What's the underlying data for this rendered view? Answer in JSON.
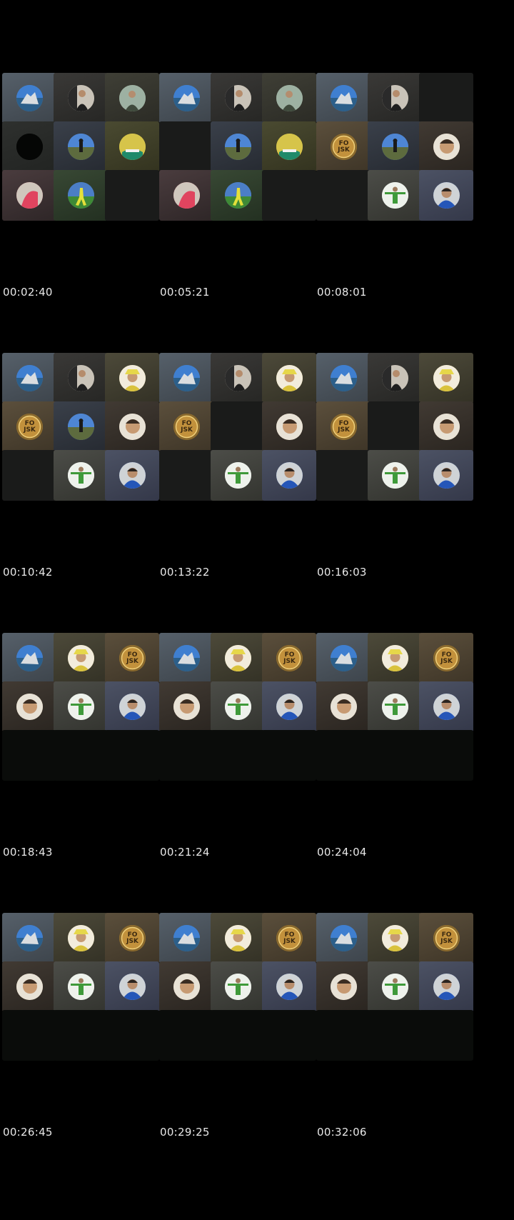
{
  "frames": [
    {
      "timestamp": "00:02:40",
      "tiles": [
        {
          "state": "avatar",
          "avatar": "sea-rock-landscape",
          "bg1": "#56606a",
          "bg2": "#3d444b",
          "av": "#4f87c8"
        },
        {
          "state": "avatar",
          "avatar": "man-selfie-dark",
          "bg1": "#3a3937",
          "bg2": "#262624",
          "av": "#7d7568"
        },
        {
          "state": "avatar",
          "avatar": "man-outdoor-green",
          "bg1": "#3f3f36",
          "bg2": "#2b2b25",
          "av": "#8c9a88"
        },
        {
          "state": "avatar",
          "avatar": "black-circle",
          "bg1": "#2e302e",
          "bg2": "#222422",
          "av": "#050605"
        },
        {
          "state": "avatar",
          "avatar": "person-blue-sky",
          "bg1": "#3a404a",
          "bg2": "#262a31",
          "av": "#5c8ed8"
        },
        {
          "state": "avatar",
          "avatar": "yellow-green-logo",
          "bg1": "#4a4a31",
          "bg2": "#33331f",
          "av": "#c9b63a"
        },
        {
          "state": "avatar",
          "avatar": "person-red-shirt",
          "bg1": "#4a3c3e",
          "bg2": "#2e2627",
          "av": "#d9556b"
        },
        {
          "state": "avatar",
          "avatar": "runner-green-field",
          "bg1": "#384834",
          "bg2": "#233021",
          "av": "#4a7fc1"
        },
        {
          "state": "empty"
        }
      ]
    },
    {
      "timestamp": "00:05:21",
      "tiles": [
        {
          "state": "avatar",
          "avatar": "sea-rock-landscape",
          "bg1": "#56606a",
          "bg2": "#3d444b",
          "av": "#4f87c8"
        },
        {
          "state": "avatar",
          "avatar": "man-selfie-dark",
          "bg1": "#3a3937",
          "bg2": "#262624",
          "av": "#7d7568"
        },
        {
          "state": "avatar",
          "avatar": "man-outdoor-green",
          "bg1": "#3f3f36",
          "bg2": "#2b2b25",
          "av": "#8c9a88"
        },
        {
          "state": "empty"
        },
        {
          "state": "avatar",
          "avatar": "person-blue-sky",
          "bg1": "#3a404a",
          "bg2": "#262a31",
          "av": "#5c8ed8"
        },
        {
          "state": "avatar",
          "avatar": "yellow-green-logo",
          "bg1": "#4a4a31",
          "bg2": "#33331f",
          "av": "#c9b63a"
        },
        {
          "state": "avatar",
          "avatar": "person-red-shirt",
          "bg1": "#4a3c3e",
          "bg2": "#2e2627",
          "av": "#d9556b"
        },
        {
          "state": "avatar",
          "avatar": "runner-green-field",
          "bg1": "#384834",
          "bg2": "#233021",
          "av": "#4a7fc1"
        },
        {
          "state": "empty"
        }
      ]
    },
    {
      "timestamp": "00:08:01",
      "tiles": [
        {
          "state": "avatar",
          "avatar": "sea-rock-landscape",
          "bg1": "#56606a",
          "bg2": "#3d444b",
          "av": "#4f87c8"
        },
        {
          "state": "avatar",
          "avatar": "man-selfie-dark",
          "bg1": "#3a3937",
          "bg2": "#262624",
          "av": "#7d7568"
        },
        {
          "state": "empty"
        },
        {
          "state": "avatar",
          "avatar": "gold-emblem",
          "label": "FO\nJSK",
          "bg1": "#5b4f3c",
          "bg2": "#3e3527",
          "av": "#a67c2d"
        },
        {
          "state": "avatar",
          "avatar": "person-blue-sky",
          "bg1": "#3a404a",
          "bg2": "#262a31",
          "av": "#5c8ed8"
        },
        {
          "state": "avatar",
          "avatar": "man-selfie-light",
          "bg1": "#413a33",
          "bg2": "#2a2520",
          "av": "#b89873"
        },
        {
          "state": "empty"
        },
        {
          "state": "avatar",
          "avatar": "man-arms-out-green",
          "bg1": "#4c4d48",
          "bg2": "#33342f",
          "av": "#e6ede3"
        },
        {
          "state": "avatar",
          "avatar": "man-blue-hoodie",
          "bg1": "#4c5264",
          "bg2": "#343849",
          "av": "#2b59b8"
        }
      ]
    },
    {
      "timestamp": "00:10:42",
      "tiles": [
        {
          "state": "avatar",
          "avatar": "sea-rock-landscape",
          "bg1": "#56606a",
          "bg2": "#3d444b",
          "av": "#4f87c8"
        },
        {
          "state": "avatar",
          "avatar": "man-selfie-dark",
          "bg1": "#3a3937",
          "bg2": "#262624",
          "av": "#7d7568"
        },
        {
          "state": "avatar",
          "avatar": "man-yellow-hat",
          "bg1": "#4d4a3a",
          "bg2": "#333125",
          "av": "#d6c35a"
        },
        {
          "state": "avatar",
          "avatar": "gold-emblem",
          "label": "FO\nJSK",
          "bg1": "#5b4f3c",
          "bg2": "#3e3527",
          "av": "#a67c2d"
        },
        {
          "state": "avatar",
          "avatar": "person-blue-sky",
          "bg1": "#3a404a",
          "bg2": "#262a31",
          "av": "#5c8ed8"
        },
        {
          "state": "avatar",
          "avatar": "man-selfie-light",
          "bg1": "#413a33",
          "bg2": "#2a2520",
          "av": "#b89873"
        },
        {
          "state": "empty"
        },
        {
          "state": "avatar",
          "avatar": "man-arms-out-green",
          "bg1": "#4c4d48",
          "bg2": "#33342f",
          "av": "#e6ede3"
        },
        {
          "state": "avatar",
          "avatar": "man-blue-hoodie",
          "bg1": "#4c5264",
          "bg2": "#343849",
          "av": "#2b59b8"
        }
      ]
    },
    {
      "timestamp": "00:13:22",
      "tiles": [
        {
          "state": "avatar",
          "avatar": "sea-rock-landscape",
          "bg1": "#56606a",
          "bg2": "#3d444b",
          "av": "#4f87c8"
        },
        {
          "state": "avatar",
          "avatar": "man-selfie-dark",
          "bg1": "#3a3937",
          "bg2": "#262624",
          "av": "#7d7568"
        },
        {
          "state": "avatar",
          "avatar": "man-yellow-hat",
          "bg1": "#4d4a3a",
          "bg2": "#333125",
          "av": "#d6c35a"
        },
        {
          "state": "avatar",
          "avatar": "gold-emblem",
          "label": "FO\nJSK",
          "bg1": "#5b4f3c",
          "bg2": "#3e3527",
          "av": "#a67c2d"
        },
        {
          "state": "empty"
        },
        {
          "state": "avatar",
          "avatar": "man-selfie-light",
          "bg1": "#413a33",
          "bg2": "#2a2520",
          "av": "#b89873"
        },
        {
          "state": "empty"
        },
        {
          "state": "avatar",
          "avatar": "man-arms-out-green",
          "bg1": "#4c4d48",
          "bg2": "#33342f",
          "av": "#e6ede3"
        },
        {
          "state": "avatar",
          "avatar": "man-blue-hoodie",
          "bg1": "#4c5264",
          "bg2": "#343849",
          "av": "#2b59b8"
        }
      ]
    },
    {
      "timestamp": "00:16:03",
      "tiles": [
        {
          "state": "avatar",
          "avatar": "sea-rock-landscape",
          "bg1": "#56606a",
          "bg2": "#3d444b",
          "av": "#4f87c8"
        },
        {
          "state": "avatar",
          "avatar": "man-selfie-dark",
          "bg1": "#3a3937",
          "bg2": "#262624",
          "av": "#7d7568"
        },
        {
          "state": "avatar",
          "avatar": "man-yellow-hat",
          "bg1": "#4d4a3a",
          "bg2": "#333125",
          "av": "#d6c35a"
        },
        {
          "state": "avatar",
          "avatar": "gold-emblem",
          "label": "FO\nJSK",
          "bg1": "#5b4f3c",
          "bg2": "#3e3527",
          "av": "#a67c2d"
        },
        {
          "state": "empty"
        },
        {
          "state": "avatar",
          "avatar": "man-selfie-light",
          "bg1": "#413a33",
          "bg2": "#2a2520",
          "av": "#b89873"
        },
        {
          "state": "empty"
        },
        {
          "state": "avatar",
          "avatar": "man-arms-out-green",
          "bg1": "#4c4d48",
          "bg2": "#33342f",
          "av": "#e6ede3"
        },
        {
          "state": "avatar",
          "avatar": "man-blue-hoodie",
          "bg1": "#4c5264",
          "bg2": "#343849",
          "av": "#2b59b8"
        }
      ]
    },
    {
      "timestamp": "00:18:43",
      "tiles": [
        {
          "state": "avatar",
          "avatar": "sea-rock-landscape",
          "bg1": "#56606a",
          "bg2": "#3d444b",
          "av": "#4f87c8"
        },
        {
          "state": "avatar",
          "avatar": "man-yellow-hat",
          "bg1": "#4d4a3a",
          "bg2": "#333125",
          "av": "#d6c35a"
        },
        {
          "state": "avatar",
          "avatar": "gold-emblem",
          "label": "FO\nJSK",
          "bg1": "#5b4f3c",
          "bg2": "#3e3527",
          "av": "#a67c2d"
        },
        {
          "state": "avatar",
          "avatar": "man-selfie-light",
          "bg1": "#413a33",
          "bg2": "#2a2520",
          "av": "#b89873"
        },
        {
          "state": "avatar",
          "avatar": "man-arms-out-green",
          "bg1": "#4c4d48",
          "bg2": "#33342f",
          "av": "#e6ede3"
        },
        {
          "state": "avatar",
          "avatar": "man-blue-hoodie",
          "bg1": "#4c5264",
          "bg2": "#343849",
          "av": "#2b59b8"
        },
        {
          "state": "empty-dark"
        },
        {
          "state": "empty-dark"
        },
        {
          "state": "empty-dark"
        }
      ]
    },
    {
      "timestamp": "00:21:24",
      "tiles": [
        {
          "state": "avatar",
          "avatar": "sea-rock-landscape",
          "bg1": "#56606a",
          "bg2": "#3d444b",
          "av": "#4f87c8"
        },
        {
          "state": "avatar",
          "avatar": "man-yellow-hat",
          "bg1": "#4d4a3a",
          "bg2": "#333125",
          "av": "#d6c35a"
        },
        {
          "state": "avatar",
          "avatar": "gold-emblem",
          "label": "FO\nJSK",
          "bg1": "#5b4f3c",
          "bg2": "#3e3527",
          "av": "#a67c2d"
        },
        {
          "state": "avatar",
          "avatar": "man-selfie-light",
          "bg1": "#413a33",
          "bg2": "#2a2520",
          "av": "#b89873"
        },
        {
          "state": "avatar",
          "avatar": "man-arms-out-green",
          "bg1": "#4c4d48",
          "bg2": "#33342f",
          "av": "#e6ede3"
        },
        {
          "state": "avatar",
          "avatar": "man-blue-hoodie",
          "bg1": "#4c5264",
          "bg2": "#343849",
          "av": "#2b59b8"
        },
        {
          "state": "empty-dark"
        },
        {
          "state": "empty-dark"
        },
        {
          "state": "empty-dark"
        }
      ]
    },
    {
      "timestamp": "00:24:04",
      "tiles": [
        {
          "state": "avatar",
          "avatar": "sea-rock-landscape",
          "bg1": "#56606a",
          "bg2": "#3d444b",
          "av": "#4f87c8"
        },
        {
          "state": "avatar",
          "avatar": "man-yellow-hat",
          "bg1": "#4d4a3a",
          "bg2": "#333125",
          "av": "#d6c35a"
        },
        {
          "state": "avatar",
          "avatar": "gold-emblem",
          "label": "FO\nJSK",
          "bg1": "#5b4f3c",
          "bg2": "#3e3527",
          "av": "#a67c2d"
        },
        {
          "state": "avatar",
          "avatar": "man-selfie-light",
          "bg1": "#413a33",
          "bg2": "#2a2520",
          "av": "#b89873"
        },
        {
          "state": "avatar",
          "avatar": "man-arms-out-green",
          "bg1": "#4c4d48",
          "bg2": "#33342f",
          "av": "#e6ede3"
        },
        {
          "state": "avatar",
          "avatar": "man-blue-hoodie",
          "bg1": "#4c5264",
          "bg2": "#343849",
          "av": "#2b59b8"
        },
        {
          "state": "empty-dark"
        },
        {
          "state": "empty-dark"
        },
        {
          "state": "empty-dark"
        }
      ]
    },
    {
      "timestamp": "00:26:45",
      "tiles": [
        {
          "state": "avatar",
          "avatar": "sea-rock-landscape",
          "bg1": "#56606a",
          "bg2": "#3d444b",
          "av": "#4f87c8"
        },
        {
          "state": "avatar",
          "avatar": "man-yellow-hat",
          "bg1": "#4d4a3a",
          "bg2": "#333125",
          "av": "#d6c35a"
        },
        {
          "state": "avatar",
          "avatar": "gold-emblem",
          "label": "FO\nJSK",
          "bg1": "#5b4f3c",
          "bg2": "#3e3527",
          "av": "#a67c2d"
        },
        {
          "state": "avatar",
          "avatar": "man-selfie-light",
          "bg1": "#413a33",
          "bg2": "#2a2520",
          "av": "#b89873"
        },
        {
          "state": "avatar",
          "avatar": "man-arms-out-green",
          "bg1": "#4c4d48",
          "bg2": "#33342f",
          "av": "#e6ede3"
        },
        {
          "state": "avatar",
          "avatar": "man-blue-hoodie",
          "bg1": "#4c5264",
          "bg2": "#343849",
          "av": "#2b59b8"
        },
        {
          "state": "empty-dark"
        },
        {
          "state": "empty-dark"
        },
        {
          "state": "empty-dark"
        }
      ]
    },
    {
      "timestamp": "00:29:25",
      "tiles": [
        {
          "state": "avatar",
          "avatar": "sea-rock-landscape",
          "bg1": "#56606a",
          "bg2": "#3d444b",
          "av": "#4f87c8"
        },
        {
          "state": "avatar",
          "avatar": "man-yellow-hat",
          "bg1": "#4d4a3a",
          "bg2": "#333125",
          "av": "#d6c35a"
        },
        {
          "state": "avatar",
          "avatar": "gold-emblem",
          "label": "FO\nJSK",
          "bg1": "#5b4f3c",
          "bg2": "#3e3527",
          "av": "#a67c2d"
        },
        {
          "state": "avatar",
          "avatar": "man-selfie-light",
          "bg1": "#413a33",
          "bg2": "#2a2520",
          "av": "#b89873"
        },
        {
          "state": "avatar",
          "avatar": "man-arms-out-green",
          "bg1": "#4c4d48",
          "bg2": "#33342f",
          "av": "#e6ede3"
        },
        {
          "state": "avatar",
          "avatar": "man-blue-hoodie",
          "bg1": "#4c5264",
          "bg2": "#343849",
          "av": "#2b59b8"
        },
        {
          "state": "empty-dark"
        },
        {
          "state": "empty-dark"
        },
        {
          "state": "empty-dark"
        }
      ]
    },
    {
      "timestamp": "00:32:06",
      "tiles": [
        {
          "state": "avatar",
          "avatar": "sea-rock-landscape",
          "bg1": "#56606a",
          "bg2": "#3d444b",
          "av": "#4f87c8"
        },
        {
          "state": "avatar",
          "avatar": "man-yellow-hat",
          "bg1": "#4d4a3a",
          "bg2": "#333125",
          "av": "#d6c35a"
        },
        {
          "state": "avatar",
          "avatar": "gold-emblem",
          "label": "FO\nJSK",
          "bg1": "#5b4f3c",
          "bg2": "#3e3527",
          "av": "#a67c2d"
        },
        {
          "state": "avatar",
          "avatar": "man-selfie-light",
          "bg1": "#413a33",
          "bg2": "#2a2520",
          "av": "#b89873"
        },
        {
          "state": "avatar",
          "avatar": "man-arms-out-green",
          "bg1": "#4c4d48",
          "bg2": "#33342f",
          "av": "#e6ede3"
        },
        {
          "state": "avatar",
          "avatar": "man-blue-hoodie",
          "bg1": "#4c5264",
          "bg2": "#343849",
          "av": "#2b59b8"
        },
        {
          "state": "empty-dark"
        },
        {
          "state": "empty-dark"
        },
        {
          "state": "empty-dark"
        }
      ]
    }
  ]
}
